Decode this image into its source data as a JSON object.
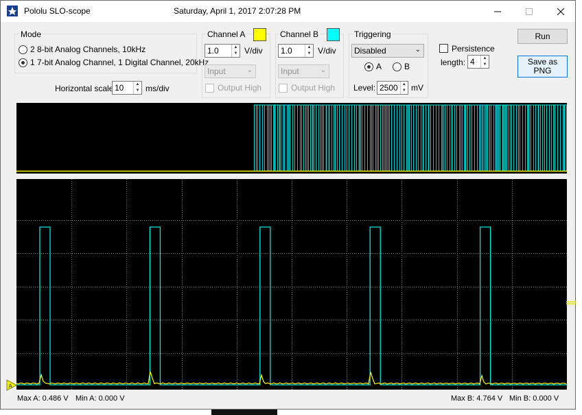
{
  "window": {
    "title": "Pololu SLO-scope",
    "datetime": "Saturday, April 1, 2017 2:07:28 PM"
  },
  "mode": {
    "label": "Mode",
    "options": [
      "2 8-bit Analog Channels, 10kHz",
      "1 7-bit Analog Channel, 1 Digital Channel, 20kHz"
    ],
    "selected_index": 1,
    "horizontal_scale_label": "Horizontal scale:",
    "horizontal_scale_value": "10",
    "horizontal_scale_unit": "ms/div"
  },
  "channel_a": {
    "label": "Channel A",
    "color": "#ffff00",
    "vdiv_value": "1.0",
    "vdiv_unit": "V/div",
    "mode_select": "Input",
    "output_high_label": "Output High"
  },
  "channel_b": {
    "label": "Channel B",
    "color": "#00ffff",
    "vdiv_value": "1.0",
    "vdiv_unit": "V/div",
    "mode_select": "Input",
    "output_high_label": "Output High"
  },
  "triggering": {
    "label": "Triggering",
    "mode": "Disabled",
    "channel_a_label": "A",
    "channel_b_label": "B",
    "selected_channel": "A",
    "level_label": "Level:",
    "level_value": "2500",
    "level_unit": "mV"
  },
  "persistence": {
    "label": "Persistence",
    "checked": false,
    "length_label": "length:",
    "length_value": "4"
  },
  "buttons": {
    "run": "Run",
    "save_png": "Save as PNG"
  },
  "trigger_marker_label": "A",
  "status": {
    "max_a": "Max A: 0.486 V",
    "min_a": "Min A: 0.000 V",
    "max_b": "Max B: 4.764 V",
    "min_b": "Min B: 0.000 V"
  },
  "colors": {
    "channel_a_trace": "#ffff00",
    "channel_b_trace": "#00e5e5",
    "scope_background": "#000000",
    "grid": "#7a7a7a"
  }
}
